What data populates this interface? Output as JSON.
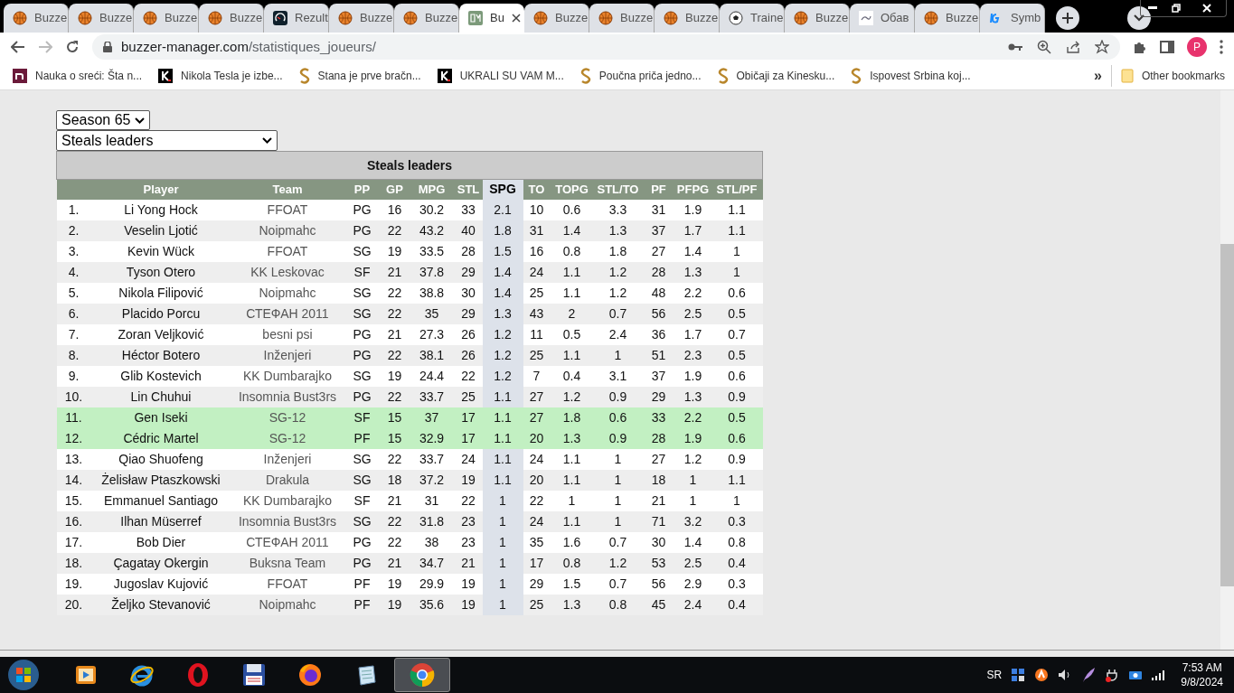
{
  "browser": {
    "tabs": [
      {
        "title": "Buzze",
        "kind": "ball",
        "selected": false
      },
      {
        "title": "Buzze",
        "kind": "ball",
        "selected": false
      },
      {
        "title": "Buzze",
        "kind": "ball",
        "selected": false
      },
      {
        "title": "Buzze",
        "kind": "ball",
        "selected": false
      },
      {
        "title": "Rezult",
        "kind": "gauge",
        "selected": false
      },
      {
        "title": "Buzze",
        "kind": "ball",
        "selected": false
      },
      {
        "title": "Buzze",
        "kind": "ball",
        "selected": false
      },
      {
        "title": "Bu",
        "kind": "bm",
        "selected": true
      },
      {
        "title": "Buzze",
        "kind": "ball",
        "selected": false
      },
      {
        "title": "Buzze",
        "kind": "ball",
        "selected": false
      },
      {
        "title": "Buzze",
        "kind": "ball",
        "selected": false
      },
      {
        "title": "Traine",
        "kind": "soccer",
        "selected": false
      },
      {
        "title": "Buzze",
        "kind": "ball",
        "selected": false
      },
      {
        "title": "Обав",
        "kind": "link",
        "selected": false
      },
      {
        "title": "Buzze",
        "kind": "ball",
        "selected": false
      },
      {
        "title": "Symb",
        "kind": "ig",
        "selected": false
      }
    ],
    "url": {
      "host": "buzzer-manager.com",
      "path": "/statistiques_joueurs/"
    },
    "profile": "P",
    "bookmarks": [
      {
        "label": "Nauka o sreći: Šta n...",
        "kind": "n"
      },
      {
        "label": "Nikola Tesla je izbe...",
        "kind": "k"
      },
      {
        "label": "Stana je prve bračn...",
        "kind": "s"
      },
      {
        "label": "UKRALI SU VAM M...",
        "kind": "k"
      },
      {
        "label": "Poučna priča jedno...",
        "kind": "s"
      },
      {
        "label": "Običaji za Kinesku...",
        "kind": "s"
      },
      {
        "label": "Ispovest Srbina koj...",
        "kind": "s"
      }
    ],
    "bookmarks_overflow": "»",
    "other_bookmarks": "Other bookmarks"
  },
  "page": {
    "season_select": "Season 65",
    "category_select": "Steals leaders",
    "table": {
      "caption": "Steals leaders",
      "columns": [
        {
          "sorted": false
        },
        {
          "label": "Player",
          "sorted": false
        },
        {
          "label": "Team",
          "sorted": false
        },
        {
          "label": "PP",
          "sorted": false
        },
        {
          "label": "GP",
          "sorted": false
        },
        {
          "label": "MPG",
          "sorted": false
        },
        {
          "label": "STL",
          "sorted": false
        },
        {
          "label": "SPG",
          "sorted": true
        },
        {
          "label": "TO",
          "sorted": false
        },
        {
          "label": "TOPG",
          "sorted": false
        },
        {
          "label": "STL/TO",
          "sorted": false
        },
        {
          "label": "PF",
          "sorted": false
        },
        {
          "label": "PFPG",
          "sorted": false
        },
        {
          "label": "STL/PF",
          "sorted": false
        }
      ],
      "rows": [
        {
          "own_team": false,
          "cells": [
            "1.",
            "Li Yong Hock",
            "FFOAT",
            "PG",
            "16",
            "30.2",
            "33",
            "2.1",
            "10",
            "0.6",
            "3.3",
            "31",
            "1.9",
            "1.1"
          ]
        },
        {
          "own_team": false,
          "cells": [
            "2.",
            "Veselin Ljotić",
            "Noipmahc",
            "PG",
            "22",
            "43.2",
            "40",
            "1.8",
            "31",
            "1.4",
            "1.3",
            "37",
            "1.7",
            "1.1"
          ]
        },
        {
          "own_team": false,
          "cells": [
            "3.",
            "Kevin Wück",
            "FFOAT",
            "SG",
            "19",
            "33.5",
            "28",
            "1.5",
            "16",
            "0.8",
            "1.8",
            "27",
            "1.4",
            "1"
          ]
        },
        {
          "own_team": false,
          "cells": [
            "4.",
            "Tyson Otero",
            "KK Leskovac",
            "SF",
            "21",
            "37.8",
            "29",
            "1.4",
            "24",
            "1.1",
            "1.2",
            "28",
            "1.3",
            "1"
          ]
        },
        {
          "own_team": false,
          "cells": [
            "5.",
            "Nikola Filipović",
            "Noipmahc",
            "SG",
            "22",
            "38.8",
            "30",
            "1.4",
            "25",
            "1.1",
            "1.2",
            "48",
            "2.2",
            "0.6"
          ]
        },
        {
          "own_team": false,
          "cells": [
            "6.",
            "Placido Porcu",
            "СТЕФАН 2011",
            "SG",
            "22",
            "35",
            "29",
            "1.3",
            "43",
            "2",
            "0.7",
            "56",
            "2.5",
            "0.5"
          ]
        },
        {
          "own_team": false,
          "cells": [
            "7.",
            "Zoran Veljković",
            "besni psi",
            "PG",
            "21",
            "27.3",
            "26",
            "1.2",
            "11",
            "0.5",
            "2.4",
            "36",
            "1.7",
            "0.7"
          ]
        },
        {
          "own_team": false,
          "cells": [
            "8.",
            "Héctor Botero",
            "Inženjeri",
            "PG",
            "22",
            "38.1",
            "26",
            "1.2",
            "25",
            "1.1",
            "1",
            "51",
            "2.3",
            "0.5"
          ]
        },
        {
          "own_team": false,
          "cells": [
            "9.",
            "Glib Kostevich",
            "KK Dumbarajko",
            "SG",
            "19",
            "24.4",
            "22",
            "1.2",
            "7",
            "0.4",
            "3.1",
            "37",
            "1.9",
            "0.6"
          ]
        },
        {
          "own_team": false,
          "cells": [
            "10.",
            "Lin Chuhui",
            "Insomnia Bust3rs",
            "PG",
            "22",
            "33.7",
            "25",
            "1.1",
            "27",
            "1.2",
            "0.9",
            "29",
            "1.3",
            "0.9"
          ]
        },
        {
          "own_team": true,
          "cells": [
            "11.",
            "Gen Iseki",
            "SG-12",
            "SF",
            "15",
            "37",
            "17",
            "1.1",
            "27",
            "1.8",
            "0.6",
            "33",
            "2.2",
            "0.5"
          ]
        },
        {
          "own_team": true,
          "cells": [
            "12.",
            "Cédric Martel",
            "SG-12",
            "PF",
            "15",
            "32.9",
            "17",
            "1.1",
            "20",
            "1.3",
            "0.9",
            "28",
            "1.9",
            "0.6"
          ]
        },
        {
          "own_team": false,
          "cells": [
            "13.",
            "Qiao Shuofeng",
            "Inženjeri",
            "SG",
            "22",
            "33.7",
            "24",
            "1.1",
            "24",
            "1.1",
            "1",
            "27",
            "1.2",
            "0.9"
          ]
        },
        {
          "own_team": false,
          "cells": [
            "14.",
            "Żelisław Ptaszkowski",
            "Drakula",
            "SG",
            "18",
            "37.2",
            "19",
            "1.1",
            "20",
            "1.1",
            "1",
            "18",
            "1",
            "1.1"
          ]
        },
        {
          "own_team": false,
          "cells": [
            "15.",
            "Emmanuel Santiago",
            "KK Dumbarajko",
            "SF",
            "21",
            "31",
            "22",
            "1",
            "22",
            "1",
            "1",
            "21",
            "1",
            "1"
          ]
        },
        {
          "own_team": false,
          "cells": [
            "16.",
            "Ilhan Müserref",
            "Insomnia Bust3rs",
            "SG",
            "22",
            "31.8",
            "23",
            "1",
            "24",
            "1.1",
            "1",
            "71",
            "3.2",
            "0.3"
          ]
        },
        {
          "own_team": false,
          "cells": [
            "17.",
            "Bob Dier",
            "СТЕФАН 2011",
            "PG",
            "22",
            "38",
            "23",
            "1",
            "35",
            "1.6",
            "0.7",
            "30",
            "1.4",
            "0.8"
          ]
        },
        {
          "own_team": false,
          "cells": [
            "18.",
            "Çagatay Okergin",
            "Buksna Team",
            "PG",
            "21",
            "34.7",
            "21",
            "1",
            "17",
            "0.8",
            "1.2",
            "53",
            "2.5",
            "0.4"
          ]
        },
        {
          "own_team": false,
          "cells": [
            "19.",
            "Jugoslav Kujović",
            "FFOAT",
            "PF",
            "19",
            "29.9",
            "19",
            "1",
            "29",
            "1.5",
            "0.7",
            "56",
            "2.9",
            "0.3"
          ]
        },
        {
          "own_team": false,
          "cells": [
            "20.",
            "Željko Stevanović",
            "Noipmahc",
            "PF",
            "19",
            "35.6",
            "19",
            "1",
            "25",
            "1.3",
            "0.8",
            "45",
            "2.4",
            "0.4"
          ]
        }
      ]
    }
  },
  "taskbar": {
    "apps": [
      {
        "kind": "media",
        "selected": false
      },
      {
        "kind": "ie",
        "selected": false
      },
      {
        "kind": "opera",
        "selected": false
      },
      {
        "kind": "floppy",
        "selected": false
      },
      {
        "kind": "firefox",
        "selected": false
      },
      {
        "kind": "notepad",
        "selected": false
      },
      {
        "kind": "chrome",
        "selected": true
      }
    ],
    "language": "SR",
    "time": "7:53 AM",
    "date": "9/8/2024"
  }
}
